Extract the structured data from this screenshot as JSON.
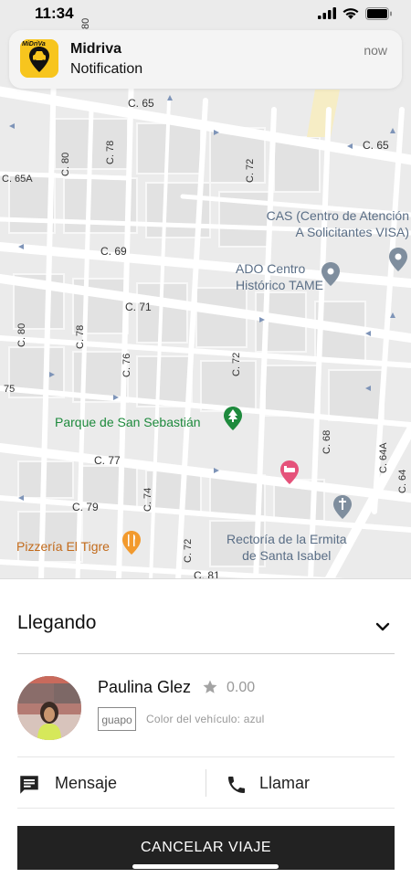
{
  "status_bar": {
    "time": "11:34"
  },
  "notification": {
    "app_name": "Midriva",
    "text": "Notification",
    "time": "now",
    "icon_text": "MiDriVa",
    "icon_name": "car-pin-logo-icon"
  },
  "map": {
    "streets": {
      "c65": "C. 65",
      "c65b": "C. 65",
      "c65a": "C. 65A",
      "c69": "C. 69",
      "c71": "C. 71",
      "c77": "C. 77",
      "c79": "C. 79",
      "c81": "C. 81",
      "c80": "C. 80",
      "c78": "C. 78",
      "c72": "C. 72",
      "c72b": "C. 72",
      "c80b": "C. 80",
      "c78b": "C. 78",
      "c76": "C. 76",
      "c68": "C. 68",
      "c74": "C. 74",
      "c72c": "C. 72",
      "c64a": "C. 64A",
      "c64": "C. 64",
      "n80": "80",
      "n75": "75"
    },
    "pois": {
      "cas_line1": "CAS (Centro de Atención",
      "cas_line2": "A Solicitantes VISA)",
      "ado_line1": "ADO Centro",
      "ado_line2": "Histórico TAME",
      "parque": "Parque de San Sebastián",
      "pizzeria": "Pizzería El Tigre",
      "rectoria_line1": "Rectoría de la Ermita",
      "rectoria_line2": "de Santa Isabel"
    }
  },
  "trip": {
    "status": "Llegando",
    "driver": {
      "name": "Paulina Glez",
      "rating": "0.00",
      "plate": "guapo",
      "vehicle_color": "Color del vehículo: azul"
    },
    "actions": {
      "message": "Mensaje",
      "call": "Llamar"
    },
    "cancel_label": "CANCELAR VIAJE"
  },
  "colors": {
    "brand_yellow": "#f7c51e",
    "button_dark": "#222222",
    "park_green": "#1e8a3d",
    "pin_blue": "#7f8e9e",
    "food_orange": "#f29a2e",
    "hotel_pink": "#e5527a"
  }
}
